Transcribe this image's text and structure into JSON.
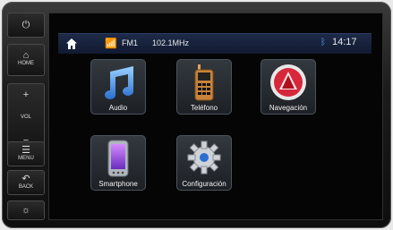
{
  "side_buttons": [
    {
      "id": "power",
      "icon": "power-icon",
      "glyph": "⏻",
      "label": ""
    },
    {
      "id": "home",
      "icon": "home-icon",
      "glyph": "⌂",
      "label": "HOME"
    },
    {
      "id": "vol-up",
      "icon": "plus-icon",
      "glyph": "+",
      "label": ""
    },
    {
      "id": "vol",
      "icon": "",
      "glyph": "",
      "label": "VOL"
    },
    {
      "id": "vol-down",
      "icon": "minus-icon",
      "glyph": "−",
      "label": ""
    },
    {
      "id": "menu",
      "icon": "menu-icon",
      "glyph": "☰",
      "label": "MENU"
    },
    {
      "id": "back",
      "icon": "back-icon",
      "glyph": "↶",
      "label": "BACK"
    },
    {
      "id": "brightness",
      "icon": "brightness-icon",
      "glyph": "☼",
      "label": ""
    }
  ],
  "statusbar": {
    "band": "FM1",
    "frequency": "102.1MHz",
    "time": "14:17"
  },
  "apps": [
    {
      "id": "audio",
      "label": "Audio",
      "icon": "music-note-icon"
    },
    {
      "id": "telefono",
      "label": "Teléfono",
      "icon": "phone-icon"
    },
    {
      "id": "navegacion",
      "label": "Navegación",
      "icon": "navigation-icon"
    },
    {
      "id": "smartphone",
      "label": "Smartphone",
      "icon": "smartphone-icon"
    },
    {
      "id": "configuracion",
      "label": "Configuración",
      "icon": "gear-icon"
    }
  ],
  "colors": {
    "accent": "#4aa0ff",
    "statusbar": "#16223c"
  }
}
